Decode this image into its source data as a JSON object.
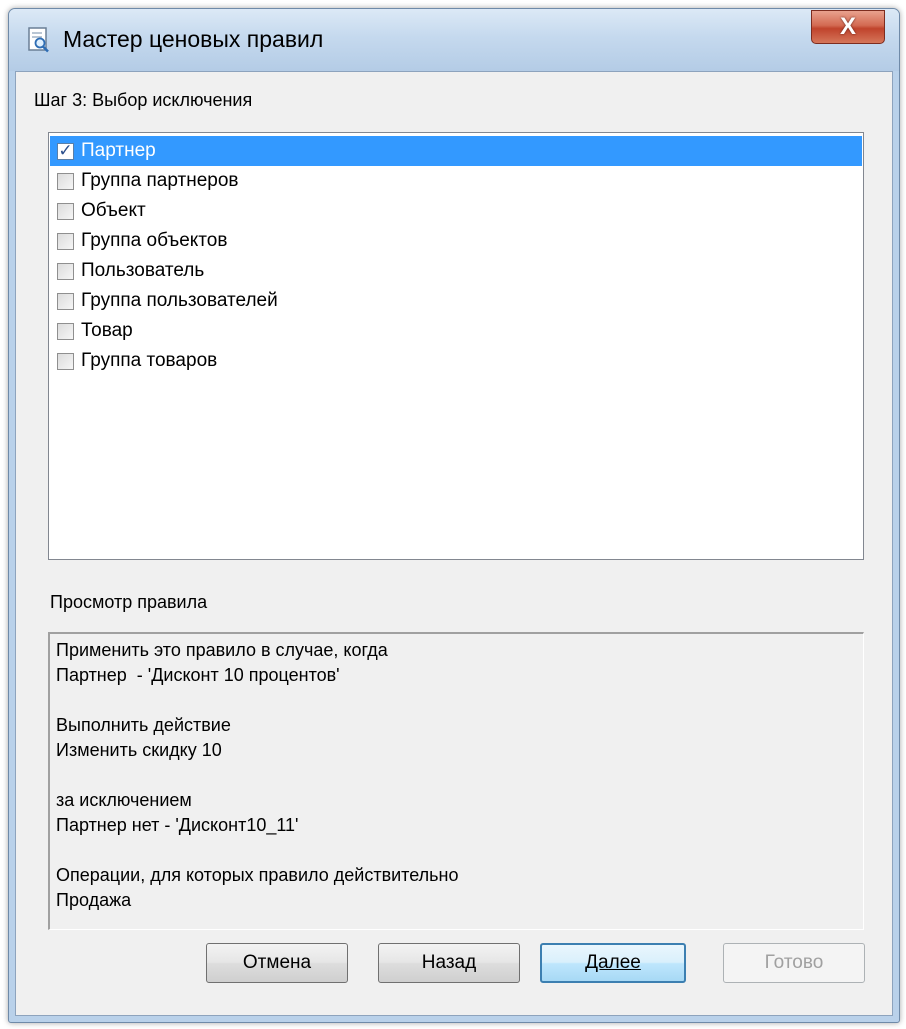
{
  "window": {
    "title": "Мастер ценовых правил",
    "close_glyph": "X"
  },
  "step": {
    "label": "Шаг 3: Выбор исключения"
  },
  "list": {
    "items": [
      {
        "label": "Партнер",
        "checked": true,
        "selected": true
      },
      {
        "label": "Группа партнеров",
        "checked": false,
        "selected": false
      },
      {
        "label": "Объект",
        "checked": false,
        "selected": false
      },
      {
        "label": "Группа объектов",
        "checked": false,
        "selected": false
      },
      {
        "label": "Пользователь",
        "checked": false,
        "selected": false
      },
      {
        "label": "Группа пользователей",
        "checked": false,
        "selected": false
      },
      {
        "label": "Товар",
        "checked": false,
        "selected": false
      },
      {
        "label": "Группа товаров",
        "checked": false,
        "selected": false
      }
    ]
  },
  "preview": {
    "label": "Просмотр правила",
    "lines": [
      "Применить это правило в случае, когда",
      "Партнер  - 'Дисконт 10 процентов'",
      "",
      "Выполнить действие",
      "Изменить скидку 10",
      "",
      "за исключением",
      "Партнер нет - 'Дисконт10_11'",
      "",
      "Операции, для которых правило действительно",
      "Продажа"
    ]
  },
  "buttons": {
    "cancel": "Отмена",
    "back": "Назад",
    "next": "Далее",
    "finish": "Готово"
  },
  "colors": {
    "selection": "#3399ff",
    "frame": "#b9d1ea",
    "close_button": "#c0432c"
  }
}
